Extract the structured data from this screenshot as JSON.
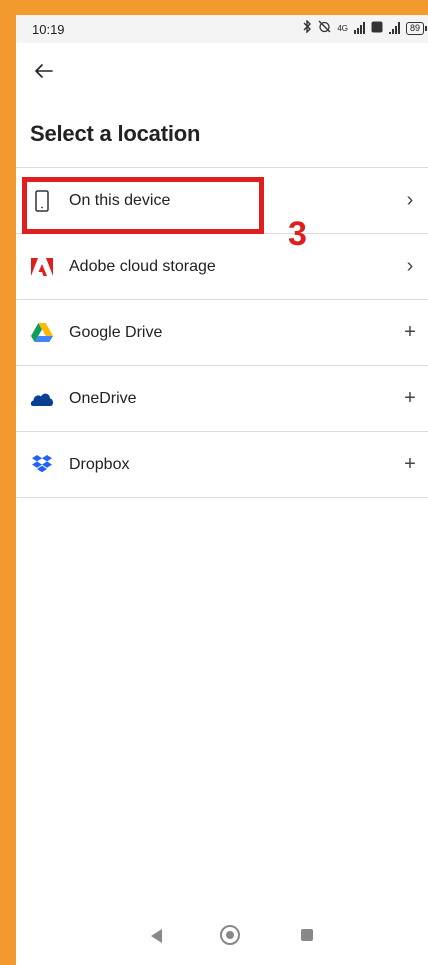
{
  "status": {
    "time": "10:19",
    "network_label": "4G",
    "battery": "89"
  },
  "page": {
    "title": "Select a location"
  },
  "locations": [
    {
      "label": "On this device",
      "trail": "›",
      "icon": "phone-icon"
    },
    {
      "label": "Adobe cloud storage",
      "trail": "›",
      "icon": "adobe-icon"
    },
    {
      "label": "Google Drive",
      "trail": "+",
      "icon": "google-drive-icon"
    },
    {
      "label": "OneDrive",
      "trail": "+",
      "icon": "onedrive-icon"
    },
    {
      "label": "Dropbox",
      "trail": "+",
      "icon": "dropbox-icon"
    }
  ],
  "annotation": {
    "step": "3",
    "color": "#e01e1e"
  },
  "colors": {
    "frame": "#f29a2e",
    "adobe": "#e11e1e",
    "onedrive": "#0a3f96",
    "dropbox": "#1f62fe"
  }
}
